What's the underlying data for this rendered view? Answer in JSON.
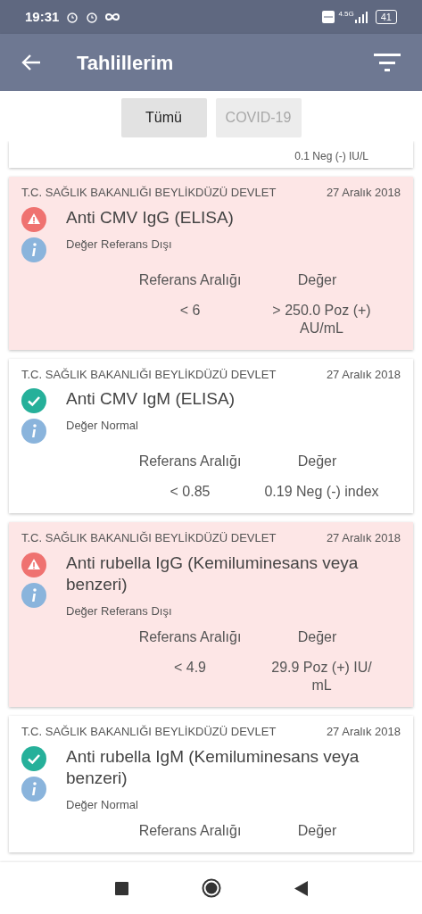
{
  "status_bar": {
    "time": "19:31",
    "network": "4.5G",
    "battery": "41"
  },
  "app_bar": {
    "title": "Tahlillerim"
  },
  "tabs": [
    {
      "label": "Tümü",
      "selected": true
    },
    {
      "label": "COVID-19",
      "selected": false
    }
  ],
  "partial_card": {
    "value": "0.1 Neg (-) IU/L"
  },
  "results": [
    {
      "kind": "abnormal",
      "hospital": "T.C. SAĞLIK BAKANLIĞI BEYLİKDÜZÜ DEVLET",
      "date": "27 Aralık 2018",
      "test": "Anti CMV IgG (ELISA)",
      "status": "Değer Referans Dışı",
      "reference_header": "Referans Aralığı",
      "value_header": "Değer",
      "reference": "< 6",
      "value": "> 250.0 Poz (+) AU/mL"
    },
    {
      "kind": "normal",
      "hospital": "T.C. SAĞLIK BAKANLIĞI BEYLİKDÜZÜ DEVLET",
      "date": "27 Aralık 2018",
      "test": "Anti CMV IgM (ELISA)",
      "status": "Değer Normal",
      "reference_header": "Referans Aralığı",
      "value_header": "Değer",
      "reference": "< 0.85",
      "value": "0.19 Neg (-) index"
    },
    {
      "kind": "abnormal",
      "hospital": "T.C. SAĞLIK BAKANLIĞI BEYLİKDÜZÜ DEVLET",
      "date": "27 Aralık 2018",
      "test": "Anti rubella IgG (Kemiluminesans veya benzeri)",
      "status": "Değer Referans Dışı",
      "reference_header": "Referans Aralığı",
      "value_header": "Değer",
      "reference": "< 4.9",
      "value": "29.9 Poz (+) IU/ mL"
    },
    {
      "kind": "normal",
      "hospital": "T.C. SAĞLIK BAKANLIĞI BEYLİKDÜZÜ DEVLET",
      "date": "27 Aralık 2018",
      "test": "Anti rubella IgM (Kemiluminesans veya benzeri)",
      "status": "Değer Normal",
      "reference_header": "Referans Aralığı",
      "value_header": "Değer"
    }
  ]
}
